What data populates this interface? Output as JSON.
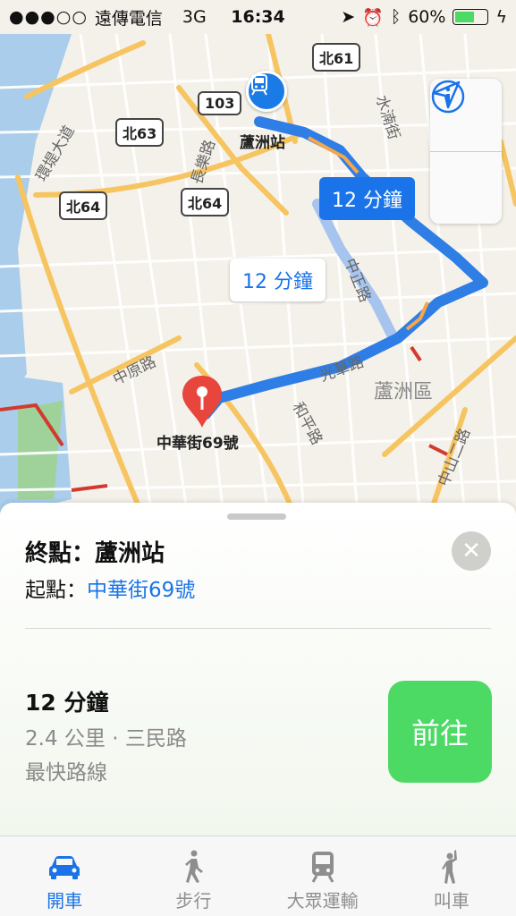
{
  "status_bar": {
    "carrier": "遠傳電信",
    "network": "3G",
    "time": "16:34",
    "battery": "60%",
    "battery_level": 0.6
  },
  "map": {
    "shields": [
      "北61",
      "103",
      "北63",
      "北64",
      "北64"
    ],
    "station_label": "蘆洲站",
    "pin_label": "中華街69號",
    "streets": [
      "環堤大道",
      "長樂路",
      "水湳街",
      "中正路",
      "中原路",
      "光華路",
      "和平路",
      "中山二路"
    ],
    "district": "蘆洲區",
    "primary_bubble": "12 分鐘",
    "secondary_bubble": "12 分鐘",
    "colors": {
      "route": "#2f7ee6",
      "route_alt": "#a6c4ee",
      "pin": "#e8453c"
    }
  },
  "card": {
    "destination": "終點：蘆洲站",
    "origin_prefix": "起點：",
    "origin_address": "中華街69號",
    "route_time": "12 分鐘",
    "route_detail": "2.4 公里 · 三民路",
    "route_note": "最快路線",
    "go_label": "前往"
  },
  "tabs": [
    {
      "label": "開車",
      "icon": "car-icon",
      "active": true
    },
    {
      "label": "步行",
      "icon": "walk-icon",
      "active": false
    },
    {
      "label": "大眾運輸",
      "icon": "transit-icon",
      "active": false
    },
    {
      "label": "叫車",
      "icon": "ride-icon",
      "active": false
    }
  ]
}
